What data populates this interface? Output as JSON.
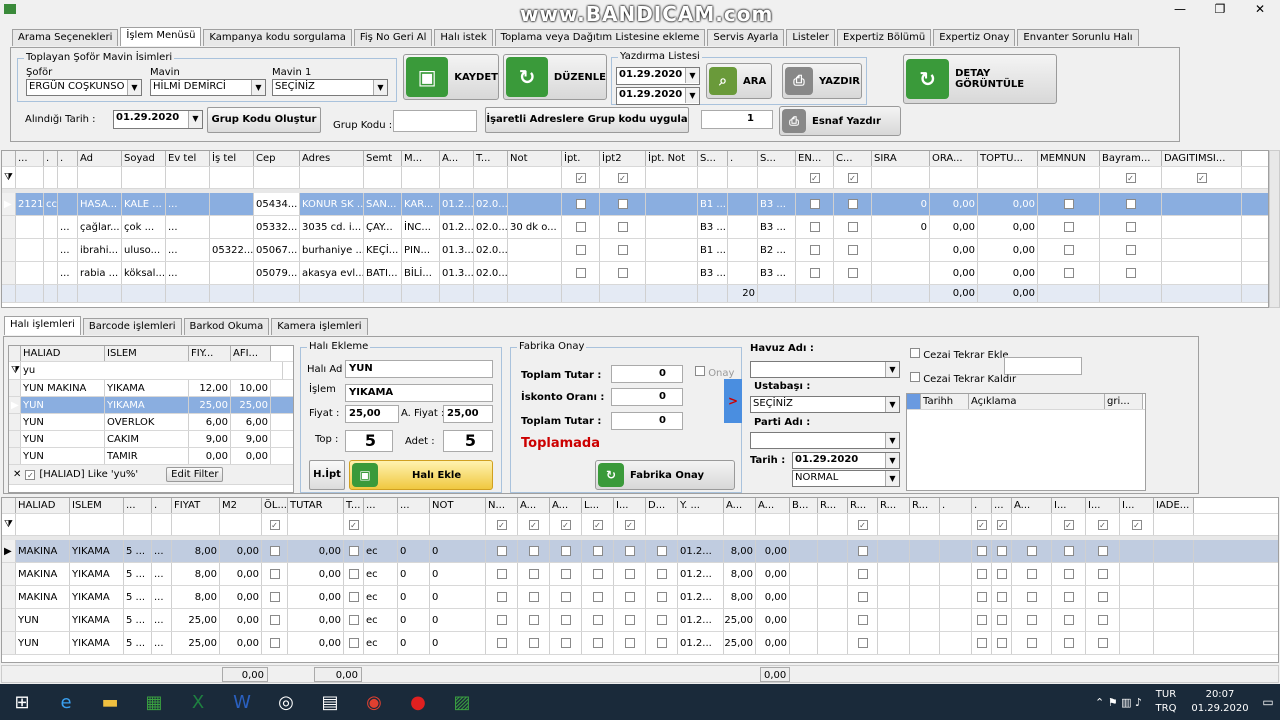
{
  "watermark": "www.BANDICAM.com",
  "tabs": [
    "Arama Seçenekleri",
    "İşlem Menüsü",
    "Kampanya kodu sorgulama",
    "Fiş No Geri Al",
    "Halı istek",
    "Toplama veya Dağıtım Listesine ekleme",
    "Servis Ayarla",
    "Listeler",
    "Expertiz Bölümü",
    "Expertiz Onay",
    "Envanter Sorunlu Halı"
  ],
  "top": {
    "group_title": "Toplayan Şoför Mavin İsimleri",
    "sofor_label": "Şoför",
    "sofor_value": "ERGÜN COŞKUNSO",
    "mavin_label": "Mavin",
    "mavin_value": "HİLMİ DEMİRCİ",
    "mavin1_label": "Mavin 1",
    "mavin1_value": "SEÇİNİZ",
    "alindigi_label": "Alındığı Tarih :",
    "alindigi_value": "01.29.2020",
    "grup_btn": "Grup Kodu Oluştur",
    "grup_kodu_label": "Grup Kodu :",
    "isaretli_btn": "İşaretli Adreslere Grup kodu uygula",
    "num_value": "1",
    "kaydet": "KAYDET",
    "duzenle": "DÜZENLE",
    "yazdirma_title": "Yazdırma Listesi",
    "date1": "01.29.2020",
    "date2": "01.29.2020",
    "ara": "ARA",
    "yazdir": "YAZDIR",
    "esnaf": "Esnaf Yazdır",
    "detay": "DETAY GÖRÜNTÜLE"
  },
  "grid1": {
    "headers": [
      "...",
      ".",
      ".",
      "Ad",
      "Soyad",
      "Ev tel",
      "İş tel",
      "Cep",
      "Adres",
      "Semt",
      "M...",
      "A...",
      "T...",
      "Not",
      "İpt.",
      "İpt2",
      "İpt. Not",
      "S...",
      ".",
      "S...",
      "EN...",
      "C...",
      "SIRA",
      "ORA...",
      "TOPTU...",
      "MEMNUN",
      "Bayram...",
      "DAGITIMSI..."
    ],
    "rows": [
      [
        "2121",
        "cc",
        "",
        "HASA...",
        "KALE ...",
        "...",
        "",
        "05434...",
        "KONUR SK ...",
        "SAN...",
        "KAR...",
        "01.2...",
        "02.0...",
        "",
        "",
        "",
        "",
        "B1 ...",
        "",
        "B3 ...",
        "",
        "",
        "0",
        "0,00",
        "0,00",
        "",
        "",
        ""
      ],
      [
        "",
        "",
        "...",
        "çağlar...",
        "çok ...",
        "...",
        "",
        "05332...",
        "3035 cd. i...",
        "ÇAY...",
        "İNC...",
        "01.2...",
        "02.0...",
        "30 dk o...",
        "",
        "",
        "",
        "B3 ...",
        "",
        "B3 ...",
        "",
        "",
        "0",
        "0,00",
        "0,00",
        "",
        "",
        ""
      ],
      [
        "",
        "",
        "...",
        "ibrahi...",
        "uluso...",
        "...",
        "05322...",
        "05067...",
        "burhaniye ...",
        "KEÇİ...",
        "PIN...",
        "01.3...",
        "02.0...",
        "",
        "",
        "",
        "",
        "B1 ...",
        "",
        "B2 ...",
        "",
        "",
        "",
        "0,00",
        "0,00",
        "",
        "",
        ""
      ],
      [
        "",
        "",
        "...",
        "rabia ...",
        "köksal...",
        "...",
        "",
        "05079...",
        "akasya evl...",
        "BATI...",
        "BİLİ...",
        "01.3...",
        "02.0...",
        "",
        "",
        "",
        "",
        "B3 ...",
        "",
        "B3 ...",
        "",
        "",
        "",
        "0,00",
        "0,00",
        "",
        "",
        ""
      ]
    ],
    "footer_count": "20",
    "footer_v1": "0,00",
    "footer_v2": "0,00"
  },
  "subtabs": [
    "Halı işlemleri",
    "Barcode işlemleri",
    "Barkod Okuma",
    "Kamera işlemleri"
  ],
  "halgrid": {
    "headers": [
      "HALIAD",
      "ISLEM",
      "FIY...",
      "AFI..."
    ],
    "filter": "yu",
    "rows": [
      [
        "YUN MAKINA",
        "YIKAMA",
        "12,00",
        "10,00"
      ],
      [
        "YUN",
        "YIKAMA",
        "25,00",
        "25,00"
      ],
      [
        "YUN",
        "OVERLOK",
        "6,00",
        "6,00"
      ],
      [
        "YUN",
        "CAKIM",
        "9,00",
        "9,00"
      ],
      [
        "YUN",
        "TAMIR",
        "0,00",
        "0,00"
      ]
    ],
    "filter_text": "[HALIAD] Like 'yu%'",
    "edit_filter": "Edit Filter"
  },
  "hali_ekleme": {
    "title": "Halı Ekleme",
    "hali_ad_label": "Halı Ad",
    "hali_ad": "YUN",
    "islem_label": "İşlem",
    "islem": "YIKAMA",
    "fiyat_label": "Fiyat :",
    "fiyat": "25,00",
    "afiyat_label": "A. Fiyat :",
    "afiyat": "25,00",
    "top_label": "Top :",
    "top": "5",
    "adet_label": "Adet :",
    "adet": "5",
    "hipt": "H.İpt",
    "ekle": "Halı Ekle"
  },
  "fabrika": {
    "title": "Fabrika Onay",
    "onay": "Onay",
    "toplam_label": "Toplam Tutar :",
    "toplam": "0",
    "iskonto_label": "İskonto Oranı :",
    "iskonto": "0",
    "toplam2_label": "Toplam Tutar :",
    "toplam2": "0",
    "status": "Toplamada",
    "btn": "Fabrika Onay"
  },
  "right": {
    "havuz_label": "Havuz Adı :",
    "usta_label": "Ustabaşı :",
    "usta": "SEÇİNİZ",
    "parti_label": "Parti Adı :",
    "tarih_label": "Tarih :",
    "tarih": "01.29.2020",
    "normal": "NORMAL",
    "cezai1": "Cezai Tekrar Ekle",
    "cezai2": "Cezai Tekrar Kaldır",
    "tbl_headers": [
      "Tarihh",
      "Açıklama",
      "gri..."
    ]
  },
  "grid2": {
    "headers": [
      "HALIAD",
      "ISLEM",
      "...",
      ".",
      "FIYAT",
      "M2",
      "ÖL...",
      "TUTAR",
      "T...",
      "...",
      "...",
      "NOT",
      "N...",
      "A...",
      "A...",
      "L...",
      "I...",
      "D...",
      "Y. ...",
      "A...",
      "A...",
      "B...",
      "R...",
      "R...",
      "R...",
      "R...",
      ".",
      ".",
      "...",
      "A...",
      "I...",
      "I...",
      "I...",
      "IADE..."
    ],
    "rows": [
      [
        "MAKINA",
        "YIKAMA",
        "5 ...",
        "...",
        "8,00",
        "0,00",
        "",
        "0,00",
        "",
        "ec",
        "0",
        "0",
        "",
        "",
        "",
        "",
        "",
        "",
        "01.2...",
        "8,00",
        "0,00"
      ],
      [
        "MAKINA",
        "YIKAMA",
        "5 ...",
        "...",
        "8,00",
        "0,00",
        "",
        "0,00",
        "",
        "ec",
        "0",
        "0",
        "",
        "",
        "",
        "",
        "",
        "",
        "01.2...",
        "8,00",
        "0,00"
      ],
      [
        "MAKINA",
        "YIKAMA",
        "5 ...",
        "...",
        "8,00",
        "0,00",
        "",
        "0,00",
        "",
        "ec",
        "0",
        "0",
        "",
        "",
        "",
        "",
        "",
        "",
        "01.2...",
        "8,00",
        "0,00"
      ],
      [
        "YUN",
        "YIKAMA",
        "5 ...",
        "...",
        "25,00",
        "0,00",
        "",
        "0,00",
        "",
        "ec",
        "0",
        "0",
        "",
        "",
        "",
        "",
        "",
        "",
        "01.2...",
        "25,00",
        "0,00"
      ],
      [
        "YUN",
        "YIKAMA",
        "5 ...",
        "...",
        "25,00",
        "0,00",
        "",
        "0,00",
        "",
        "ec",
        "0",
        "0",
        "",
        "",
        "",
        "",
        "",
        "",
        "01.2...",
        "25,00",
        "0,00"
      ]
    ],
    "footer": [
      "0,00",
      "0,00",
      "0,00"
    ]
  },
  "taskbar": {
    "lang1": "TUR",
    "lang2": "TRQ",
    "time": "20:07",
    "date": "01.29.2020"
  }
}
